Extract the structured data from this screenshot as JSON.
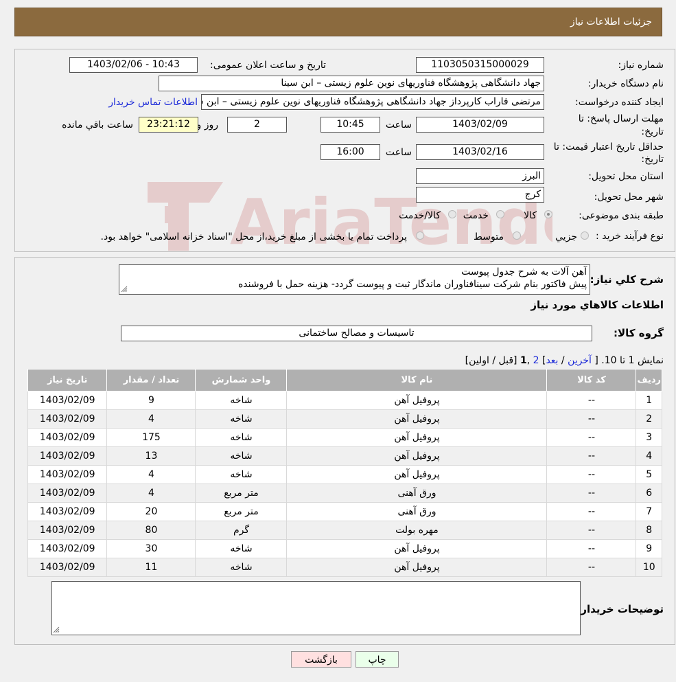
{
  "header": {
    "title": "جزئیات اطلاعات نیاز"
  },
  "form": {
    "need_number_label": "شماره نیاز:",
    "need_number": "1103050315000029",
    "announce_label": "تاریخ و ساعت اعلان عمومی:",
    "announce_value": "1403/02/06 - 10:43",
    "buyer_label": "نام دستگاه خریدار:",
    "buyer_value": "جهاد دانشگاهی پژوهشگاه فناوریهای نوین علوم زیستی – ابن سینا",
    "creator_label": "ایجاد کننده درخواست:",
    "creator_value": "مرتضی فاراب کارپرداز جهاد دانشگاهی پژوهشگاه فناوریهای نوین علوم زیستی – ابن سینا",
    "contact_link": "اطلاعات تماس خریدار",
    "deadline_label_1": "مهلت ارسال پاسخ: تا",
    "deadline_label_2": "تاریخ:",
    "deadline_date": "1403/02/09",
    "time_label": "ساعت",
    "deadline_time": "10:45",
    "days_value": "2",
    "days_label": "روز و",
    "remaining_value": "23:21:12",
    "remaining_label": "ساعت باقي مانده",
    "validity_label_1": "حداقل تاریخ اعتبار قیمت: تا",
    "validity_label_2": "تاریخ:",
    "validity_date": "1403/02/16",
    "validity_time": "16:00",
    "province_label": "استان محل تحویل:",
    "province_value": "البرز",
    "city_label": "شهر محل تحویل:",
    "city_value": "کرج",
    "category_label": "طبقه بندی موضوعی:",
    "category_options": [
      "کالا",
      "خدمت",
      "کالا/خدمت"
    ],
    "process_label": "نوع فرآیند خرید :",
    "process_options": [
      "جزیي",
      "متوسط"
    ],
    "process_note": "پرداخت تمام یا بخشی از مبلغ خرید،از محل \"اسناد خزانه اسلامی\" خواهد بود."
  },
  "details": {
    "description_label": "شرح کلي نیاز:",
    "description_line1": "آهن آلات به شرح جدول پیوست",
    "description_line2": "پیش فاکتور بنام شرکت سینافناوران ماندگار ثبت و پیوست گردد- هزینه حمل با فروشنده",
    "goods_info_title": "اطلاعات کالاهاي مورد نیاز",
    "group_label": "گروه کالا:",
    "group_value": "تاسیسات و مصالح ساختمانی",
    "paging": {
      "prefix": "نمایش 1 تا 10. [",
      "last": "آخرین",
      "next": "بعد",
      "page2": "2",
      "page1": "1",
      "suffix": "[قبل / اولین]"
    },
    "table": {
      "headers": [
        "ردیف",
        "کد کالا",
        "نام کالا",
        "واحد شمارش",
        "تعداد / مقدار",
        "تاریخ نیاز"
      ],
      "rows": [
        [
          "1",
          "--",
          "پروفیل آهن",
          "شاخه",
          "9",
          "1403/02/09"
        ],
        [
          "2",
          "--",
          "پروفیل آهن",
          "شاخه",
          "4",
          "1403/02/09"
        ],
        [
          "3",
          "--",
          "پروفیل آهن",
          "شاخه",
          "175",
          "1403/02/09"
        ],
        [
          "4",
          "--",
          "پروفیل آهن",
          "شاخه",
          "13",
          "1403/02/09"
        ],
        [
          "5",
          "--",
          "پروفیل آهن",
          "شاخه",
          "4",
          "1403/02/09"
        ],
        [
          "6",
          "--",
          "ورق آهنی",
          "متر مربع",
          "4",
          "1403/02/09"
        ],
        [
          "7",
          "--",
          "ورق آهنی",
          "متر مربع",
          "20",
          "1403/02/09"
        ],
        [
          "8",
          "--",
          "مهره بولت",
          "گرم",
          "80",
          "1403/02/09"
        ],
        [
          "9",
          "--",
          "پروفیل آهن",
          "شاخه",
          "30",
          "1403/02/09"
        ],
        [
          "10",
          "--",
          "پروفیل آهن",
          "شاخه",
          "11",
          "1403/02/09"
        ]
      ]
    },
    "buyer_notes_label": "توضیحات خریدار:",
    "buyer_notes_value": ""
  },
  "buttons": {
    "print": "چاپ",
    "back": "بازگشت"
  },
  "watermark": {
    "text": "AriaTender.neT"
  },
  "colors": {
    "header": "#8b6a3e",
    "link": "#1a28d8",
    "table_header": "#b0b0b0"
  }
}
